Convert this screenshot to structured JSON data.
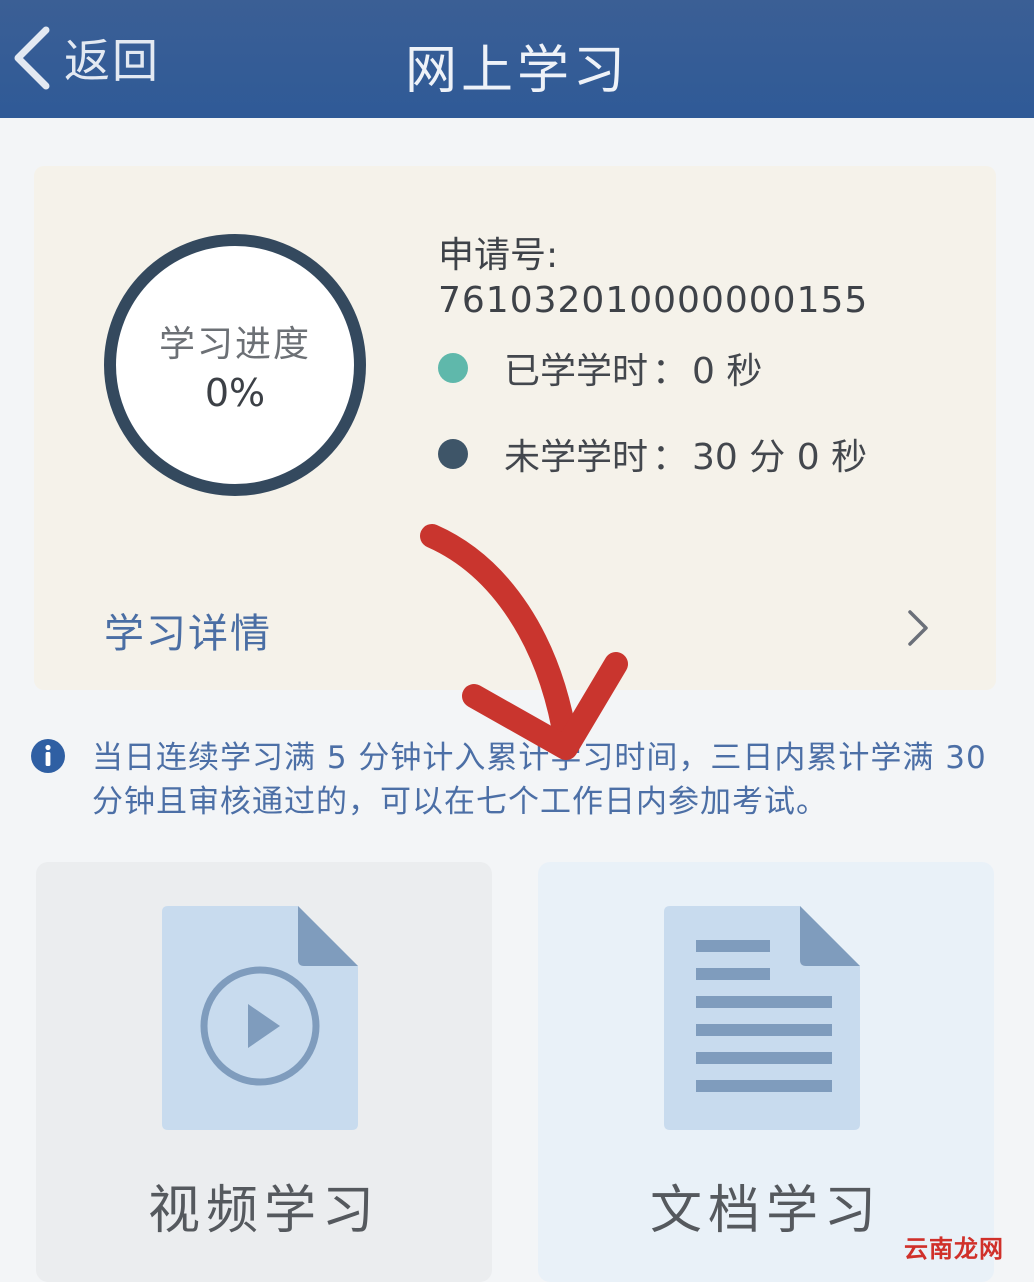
{
  "header": {
    "back_label": "返回",
    "title": "网上学习"
  },
  "progress_card": {
    "ring_title": "学习进度",
    "ring_value": "0%",
    "progress_fraction": 0,
    "application_label": "申请号:",
    "application_number": "761032010000000155",
    "studied_label": "已学学时",
    "studied_value": "0 秒",
    "remaining_label": "未学学时",
    "remaining_value": "30 分 0 秒",
    "detail_label": "学习详情"
  },
  "notice": {
    "icon": "info-icon",
    "text": "当日连续学习满 5 分钟计入累计学习时间，三日内累计学满 30 分钟且审核通过的，可以在七个工作日内参加考试。"
  },
  "tiles": [
    {
      "label": "视频学习",
      "icon": "video-file-icon"
    },
    {
      "label": "文档学习",
      "icon": "document-file-icon"
    }
  ],
  "watermark": "云南龙网",
  "colors": {
    "header_bg": "#2f5a97",
    "card_bg": "#f5f2ea",
    "ring_stroke": "#34495e",
    "studied_dot": "#5fb8ab",
    "remaining_dot": "#3e5568",
    "accent_text": "#4a6ea4",
    "annotation_arrow": "#c9352e",
    "icon_fill": "#c8dbee",
    "icon_stroke": "#7f9cbd"
  }
}
